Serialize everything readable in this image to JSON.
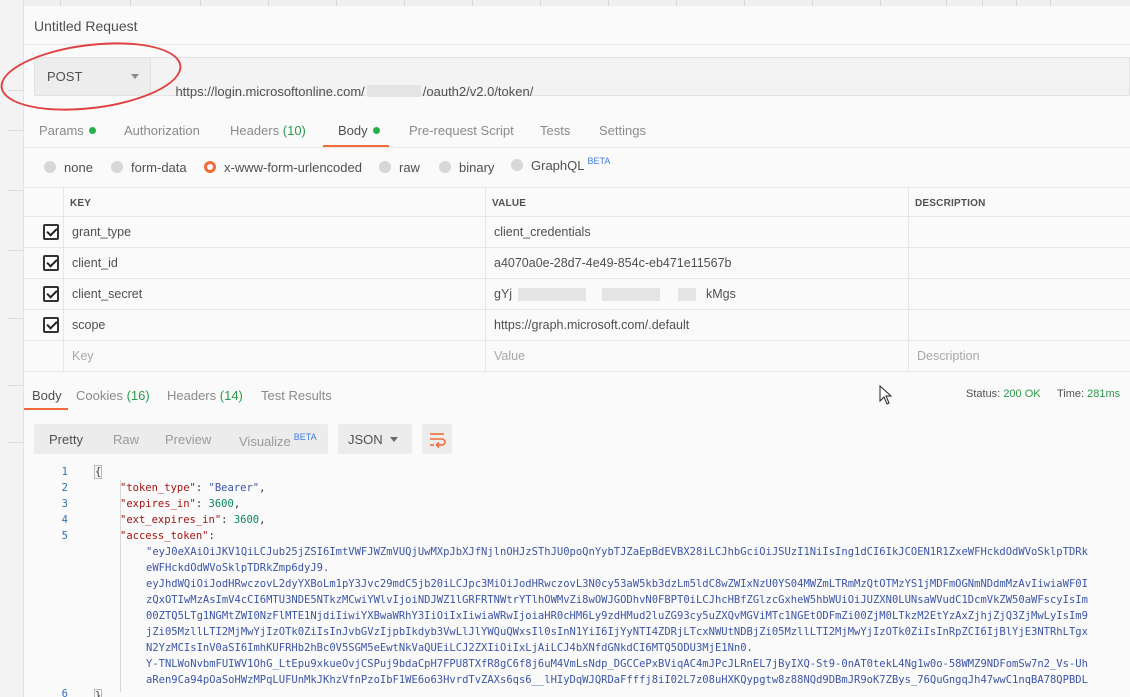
{
  "request": {
    "title": "Untitled Request",
    "method": "POST",
    "url_prefix": "https://login.microsoftonline.com/",
    "url_suffix": "/oauth2/v2.0/token/"
  },
  "request_tabs": [
    {
      "label": "Params",
      "count": "",
      "dot": true
    },
    {
      "label": "Authorization",
      "count": "",
      "dot": false
    },
    {
      "label": "Headers",
      "count": "(10)",
      "dot": false
    },
    {
      "label": "Body",
      "count": "",
      "dot": true
    },
    {
      "label": "Pre-request Script",
      "count": "",
      "dot": false
    },
    {
      "label": "Tests",
      "count": "",
      "dot": false
    },
    {
      "label": "Settings",
      "count": "",
      "dot": false
    }
  ],
  "active_request_tab": "Body",
  "body_types": [
    "none",
    "form-data",
    "x-www-form-urlencoded",
    "raw",
    "binary",
    "GraphQL"
  ],
  "selected_body_type": "x-www-form-urlencoded",
  "beta_label": "BETA",
  "params": {
    "headers": [
      "KEY",
      "VALUE",
      "DESCRIPTION"
    ],
    "rows": [
      {
        "key": "grant_type",
        "value": "client_credentials",
        "checked": true
      },
      {
        "key": "client_id",
        "value": "a4070a0e-28d7-4e49-854c-eb471e11567b",
        "checked": true
      },
      {
        "key": "client_secret",
        "value_start": "gYj",
        "value_end": "kMgs",
        "checked": true
      },
      {
        "key": "scope",
        "value": "https://graph.microsoft.com/.default",
        "checked": true
      }
    ],
    "placeholders": {
      "key": "Key",
      "value": "Value",
      "description": "Description"
    }
  },
  "response_tabs": [
    {
      "label": "Body",
      "count": ""
    },
    {
      "label": "Cookies",
      "count": "(16)"
    },
    {
      "label": "Headers",
      "count": "(14)"
    },
    {
      "label": "Test Results",
      "count": ""
    }
  ],
  "status": {
    "status_label": "Status:",
    "status_value": "200 OK",
    "time_label": "Time:",
    "time_value": "281ms"
  },
  "format_buttons": [
    "Pretty",
    "Raw",
    "Preview",
    "Visualize"
  ],
  "format_selected": "Pretty",
  "language": "JSON",
  "response_body": {
    "line_numbers": [
      "1",
      "2",
      "3",
      "4",
      "5",
      "6"
    ],
    "open_brace": "{",
    "token_type_key": "\"token_type\"",
    "token_type_value": "\"Bearer\"",
    "expires_in_key": "\"expires_in\"",
    "expires_in_value": "3600",
    "ext_expires_in_key": "\"ext_expires_in\"",
    "ext_expires_in_value": "3600",
    "access_token_key": "\"access_token\"",
    "access_token_lines": [
      "\"eyJ0eXAiOiJKV1QiLCJub25jZSI6ImtVWFJWZmVUQjUwMXpJbXJfNjlnOHJzSThJU0poQnYybTJZaEpBdEVBX28iLCJhbGciOiJSUzI1NiIsIng1dCI6IkJCOEN1R1ZxeWFHckdOdWVoSklpTDRk",
      "eWFHckdOdWVoSklpTDRkZmp6dyJ9.",
      "eyJhdWQiOiJodHRwczovL2dyYXBoLm1pY3Jvc29mdC5jb20iLCJpc3MiOiJodHRwczovL3N0cy53aW5kb3dzLm5ldC8wZWIxNzU0YS04MWZmLTRmMzQtOTMzYS1jMDFmOGNmNDdmMzAvIiwiaWF0I",
      "zQxOTIwMzAsImV4cCI6MTU3NDE5NTkzMCwiYWlvIjoiNDJWZ1lGRFRTNWtrYTlhOWMvZi8wOWJGODhvN0FBPT0iLCJhcHBfZGlzcGxheW5hbWUiOiJUZXN0LUNsaWVudC1DcmVkZW50aWFscyIsIm",
      "00ZTQ5LTg1NGMtZWI0NzFlMTE1NjdiIiwiYXBwaWRhY3IiOiIxIiwiaWRwIjoiaHR0cHM6Ly9zdHMud2luZG93cy5uZXQvMGViMTc1NGEtODFmZi00ZjM0LTkzM2EtYzAxZjhjZjQ3ZjMwLyIsIm9",
      "jZi05MzllLTI2MjMwYjIzOTk0ZiIsInJvbGVzIjpbIkdyb3VwLlJlYWQuQWxsIl0sInN1YiI6IjYyNTI4ZDRjLTcxNWUtNDBjZi05MzllLTI2MjMwYjIzOTk0ZiIsInRpZCI6IjBlYjE3NTRhLTgx",
      "N2YzMCIsInV0aSI6ImhKUFRHb2hBc0V5SGM5eEwtNkVaQUEiLCJ2ZXIiOiIxLjAiLCJ4bXNfdGNkdCI6MTQ5ODU3MjE1Nn0.",
      "Y-TNLWoNvbmFUIWV1OhG_LtEpu9xkueOvjCSPuj9bdaCpH7FPU8TXfR8gC6f8j6uM4VmLsNdp_DGCCePxBViqAC4mJPcJLRnEL7jByIXQ-St9-0nAT0tekL4Ng1w0o-58WMZ9NDFomSw7n2_Vs-Uh",
      "aRen9Ca94pOaSoHWzMPqLUFUnMkJKhzVfnPzoIbF1WE6o63HvrdTvZAXs6qs6__lHIyDqWJQRDaFfffj8iI02L7z08uHXKQypgtw8z88NQd9DBmJR9oK7ZBys_76QuGngqJh47wwC1nqBA78QPBDL"
    ],
    "close_brace": "}"
  },
  "colors": {
    "accent": "#f26b3a",
    "success": "#26b047",
    "annotation": "#e04040",
    "link_blue": "#3f7ee0"
  }
}
